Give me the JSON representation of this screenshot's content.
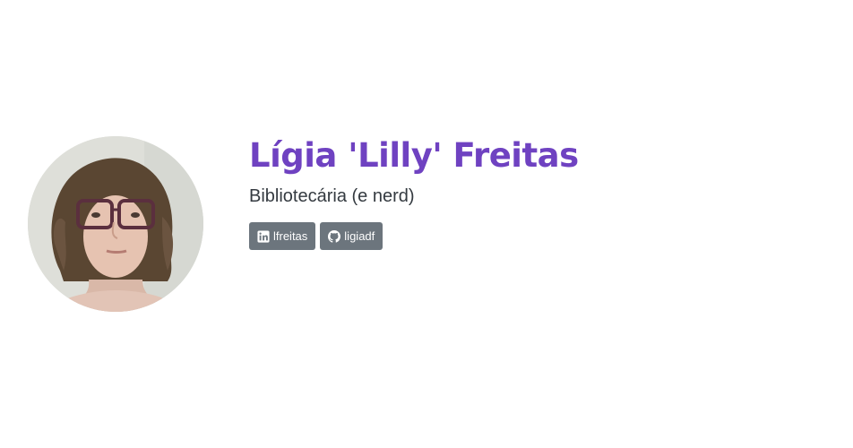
{
  "profile": {
    "name": "Lígia 'Lilly' Freitas",
    "tagline": "Bibliotecária (e nerd)",
    "name_color": "#6f42c1"
  },
  "links": [
    {
      "icon": "linkedin-icon",
      "label": "lfreitas"
    },
    {
      "icon": "github-icon",
      "label": "ligiadf"
    }
  ],
  "colors": {
    "button_bg": "#6c757d",
    "button_text": "#ffffff",
    "tagline_text": "#343a40"
  }
}
